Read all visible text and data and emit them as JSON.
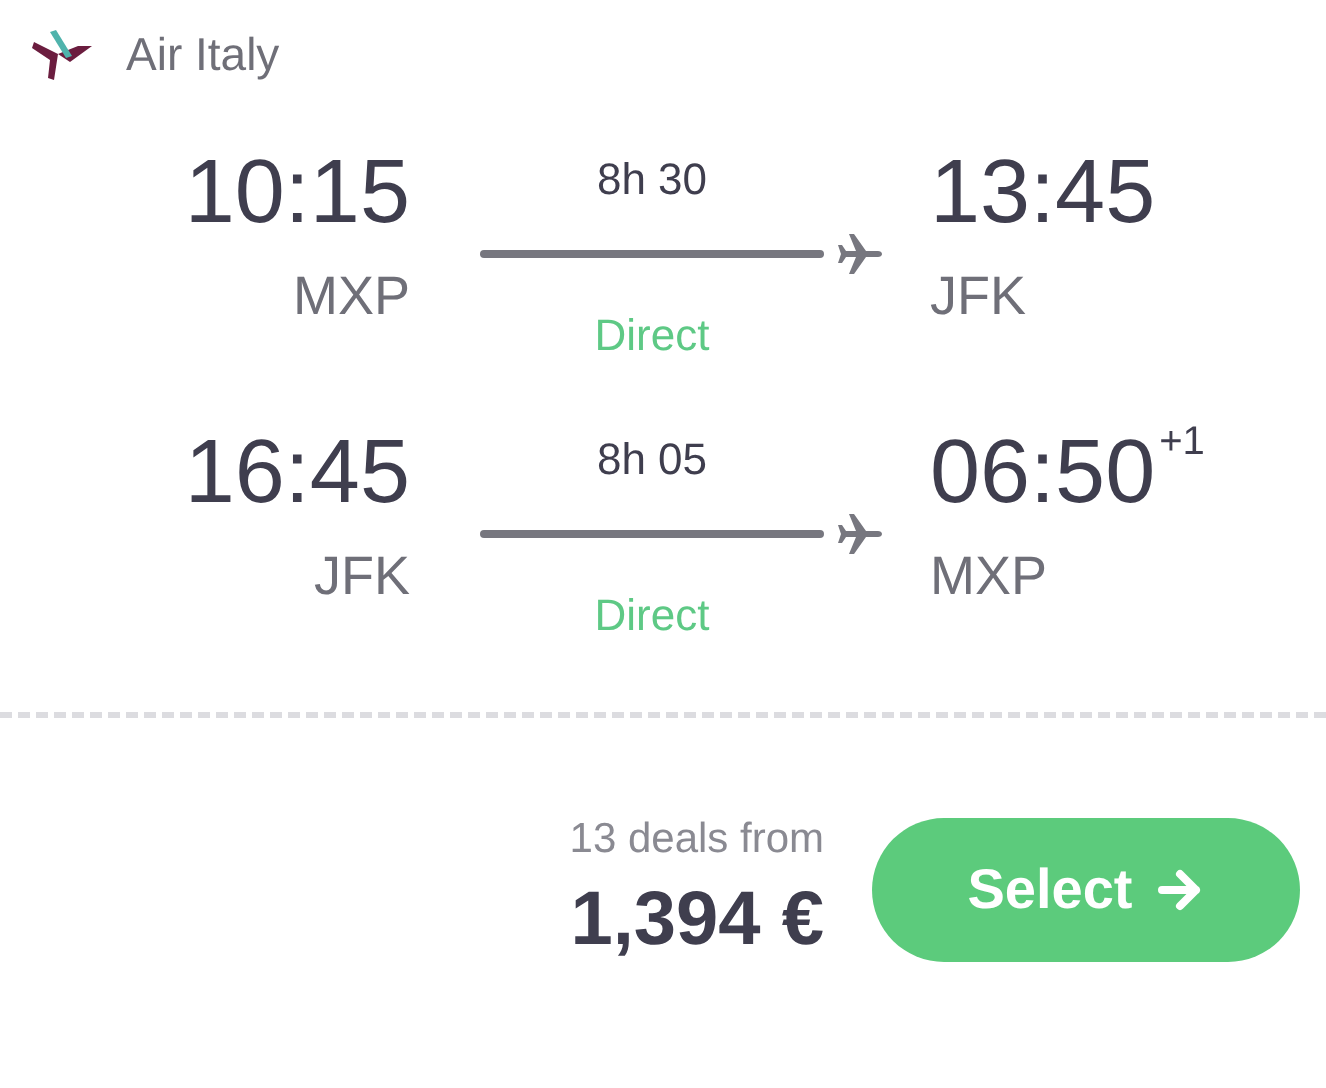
{
  "airline": {
    "name": "Air Italy"
  },
  "legs": [
    {
      "departure_time": "10:15",
      "departure_airport": "MXP",
      "duration": "8h 30",
      "stops": "Direct",
      "arrival_time": "13:45",
      "arrival_airport": "JFK"
    },
    {
      "departure_time": "16:45",
      "departure_airport": "JFK",
      "duration": "8h 05",
      "stops": "Direct",
      "arrival_time": "06:50",
      "arrival_day_offset": "+1",
      "arrival_airport": "MXP"
    }
  ],
  "deals_label": "13 deals from",
  "price": "1,394 €",
  "select_button": "Select"
}
